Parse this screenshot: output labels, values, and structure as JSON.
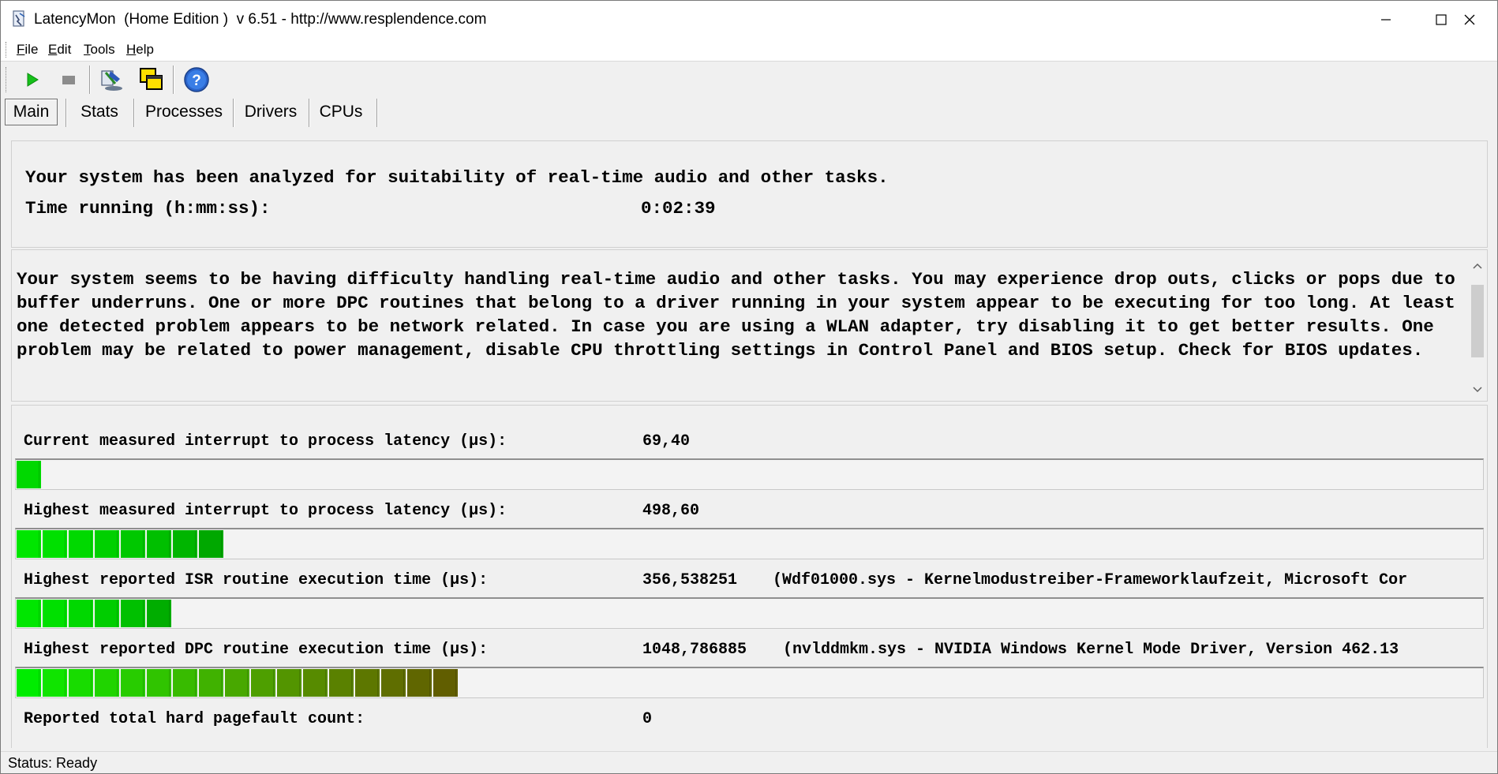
{
  "window": {
    "title": "LatencyMon  (Home Edition )  v 6.51 - http://www.resplendence.com"
  },
  "menu": [
    "File",
    "Edit",
    "Tools",
    "Help"
  ],
  "toolbar": {
    "icons": [
      "start-icon",
      "stop-icon",
      "tools-icon",
      "windows-icon",
      "help-icon"
    ]
  },
  "tabs": [
    "Main",
    "Stats",
    "Processes",
    "Drivers",
    "CPUs"
  ],
  "summary": {
    "analyzed_text": "Your system has been analyzed for suitability of real-time audio and other tasks.",
    "time_label": "Time running (h:mm:ss):",
    "time_value": "0:02:39"
  },
  "message": "Your system seems to be having difficulty handling real-time audio and other tasks. You may experience drop outs, clicks or pops due to buffer underruns. One or more DPC routines that belong to a driver running in your system appear to be executing for too long. At least one detected problem appears to be network related. In case you are using a WLAN adapter, try disabling it to get better results. One problem may be related to power management, disable CPU throttling settings in Control Panel and BIOS setup. Check for BIOS updates.",
  "metrics": [
    {
      "label": "Current measured interrupt to process latency (µs):",
      "value": "69,40",
      "detail": "",
      "segments": 1,
      "colors": [
        "#00d800"
      ]
    },
    {
      "label": "Highest measured interrupt to process latency (µs):",
      "value": "498,60",
      "detail": "",
      "segments": 8,
      "colors": [
        "#00e600",
        "#00e000",
        "#00d900",
        "#00d000",
        "#00c800",
        "#00bf00",
        "#00b500",
        "#00a800"
      ]
    },
    {
      "label": "Highest reported ISR routine execution time (µs):",
      "value": "356,538251",
      "detail": "(Wdf01000.sys - Kernelmodustreiber-Frameworklaufzeit, Microsoft Cor",
      "segments": 6,
      "colors": [
        "#00e600",
        "#00e000",
        "#00d800",
        "#00cd00",
        "#00c000",
        "#00ad00"
      ]
    },
    {
      "label": "Highest reported DPC routine execution time (µs):",
      "value": "1048,786885",
      "detail": "(nvlddmkm.sys - NVIDIA Windows Kernel Mode Driver, Version 462.13",
      "segments": 17,
      "colors": [
        "#00ec00",
        "#10e400",
        "#18dc00",
        "#20d400",
        "#28cc00",
        "#30c400",
        "#38bb00",
        "#40b200",
        "#48a800",
        "#4e9f00",
        "#539500",
        "#578b00",
        "#5a8100",
        "#5d7700",
        "#5f6e00",
        "#606600",
        "#615e00"
      ]
    },
    {
      "label": "Reported total hard pagefault count:",
      "value": "0",
      "detail": ""
    }
  ],
  "status": "Status: Ready"
}
